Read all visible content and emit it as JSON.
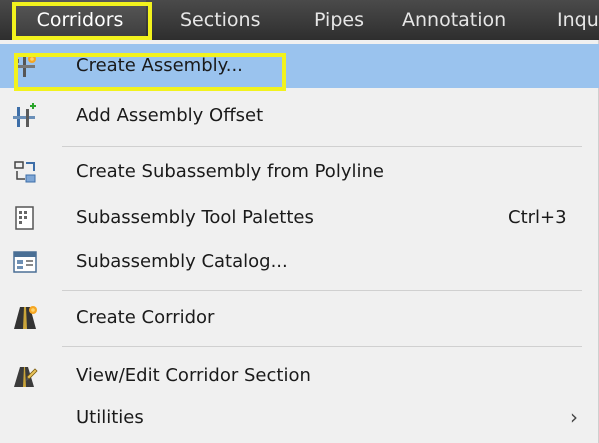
{
  "menubar": {
    "items": [
      {
        "label": "Corridors"
      },
      {
        "label": "Sections"
      },
      {
        "label": "Pipes"
      },
      {
        "label": "Annotation"
      },
      {
        "label": "Inqu"
      }
    ]
  },
  "menu": {
    "items": [
      {
        "label": "Create Assembly...",
        "icon": "assembly-icon",
        "selected": true
      },
      {
        "label": "Add Assembly Offset",
        "icon": "assembly-offset-icon"
      },
      {
        "label": "Create Subassembly from Polyline",
        "icon": "subassembly-polyline-icon"
      },
      {
        "label": "Subassembly Tool Palettes",
        "shortcut": "Ctrl+3",
        "icon": "tool-palette-icon"
      },
      {
        "label": "Subassembly Catalog...",
        "icon": "catalog-icon"
      },
      {
        "label": "Create Corridor",
        "icon": "corridor-icon"
      },
      {
        "label": "View/Edit Corridor Section",
        "icon": "corridor-section-icon"
      },
      {
        "label": "Utilities",
        "submenu_arrow": "›"
      }
    ]
  },
  "colors": {
    "highlight_box": "#f2f21d",
    "selected_row": "#9ac3ee",
    "menubar_bg": "#3a3a3a"
  }
}
